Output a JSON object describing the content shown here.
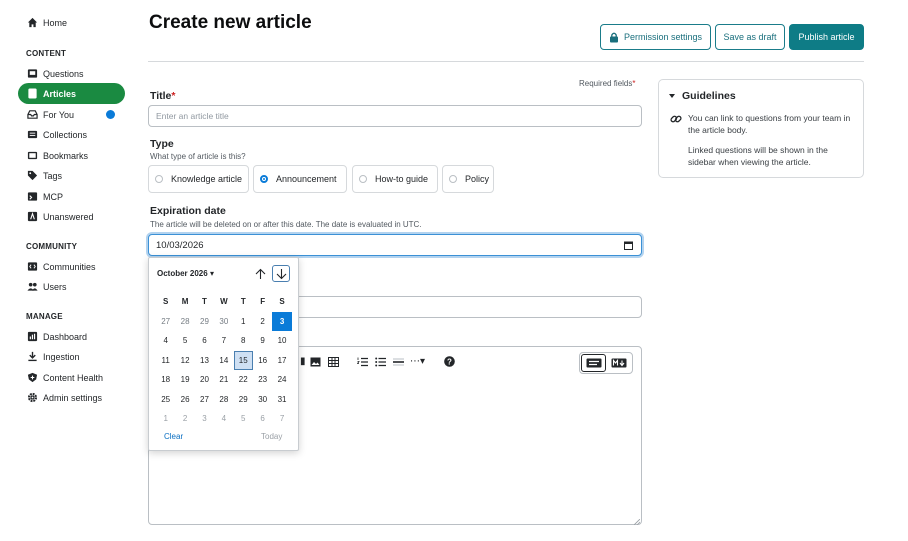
{
  "sidebar": {
    "home": "Home",
    "content_header": "CONTENT",
    "content_items": [
      {
        "label": "Questions",
        "icon": "questions-icon"
      },
      {
        "label": "Articles",
        "icon": "articles-icon",
        "active": true
      },
      {
        "label": "For You",
        "icon": "inbox-icon",
        "badge": true
      },
      {
        "label": "Collections",
        "icon": "collections-icon"
      },
      {
        "label": "Bookmarks",
        "icon": "bookmark-icon"
      },
      {
        "label": "Tags",
        "icon": "tag-icon"
      },
      {
        "label": "MCP",
        "icon": "mcp-icon"
      },
      {
        "label": "Unanswered",
        "icon": "unanswered-icon"
      }
    ],
    "community_header": "COMMUNITY",
    "community_items": [
      {
        "label": "Communities",
        "icon": "communities-icon"
      },
      {
        "label": "Users",
        "icon": "users-icon"
      }
    ],
    "manage_header": "MANAGE",
    "manage_items": [
      {
        "label": "Dashboard",
        "icon": "dashboard-icon"
      },
      {
        "label": "Ingestion",
        "icon": "ingestion-icon"
      },
      {
        "label": "Content Health",
        "icon": "health-icon"
      },
      {
        "label": "Admin settings",
        "icon": "gear-icon"
      }
    ]
  },
  "header": {
    "title": "Create new article",
    "permission_btn": "Permission settings",
    "draft_btn": "Save as draft",
    "publish_btn": "Publish article"
  },
  "form": {
    "required_note": "Required fields",
    "title_label": "Title",
    "title_placeholder": "Enter an article title",
    "type_label": "Type",
    "type_hint": "What type of article is this?",
    "type_options": [
      "Knowledge article",
      "Announcement",
      "How-to guide",
      "Policy"
    ],
    "type_selected": "Announcement",
    "expiration_label": "Expiration date",
    "expiration_hint": "The article will be deleted on or after this date. The date is evaluated in UTC.",
    "expiration_value": "10/03/2026"
  },
  "datepicker": {
    "month_label": "October 2026",
    "weekdays": [
      "S",
      "M",
      "T",
      "W",
      "T",
      "F",
      "S"
    ],
    "weeks": [
      [
        "27",
        "28",
        "29",
        "30",
        "1",
        "2",
        "3"
      ],
      [
        "4",
        "5",
        "6",
        "7",
        "8",
        "9",
        "10"
      ],
      [
        "11",
        "12",
        "13",
        "14",
        "15",
        "16",
        "17"
      ],
      [
        "18",
        "19",
        "20",
        "21",
        "22",
        "23",
        "24"
      ],
      [
        "25",
        "26",
        "27",
        "28",
        "29",
        "30",
        "31"
      ],
      [
        "1",
        "2",
        "3",
        "4",
        "5",
        "6",
        "7"
      ]
    ],
    "selected_day": "3",
    "hovered_day": "15",
    "clear_label": "Clear",
    "today_label": "Today"
  },
  "guidelines": {
    "title": "Guidelines",
    "text1": "You can link to questions from your team in the article body.",
    "text2": "Linked questions will be shown in the sidebar when viewing the article."
  },
  "colors": {
    "accent": "#0e7c86",
    "active_nav": "#1a8a41",
    "selected_day": "#0a7bd8"
  }
}
